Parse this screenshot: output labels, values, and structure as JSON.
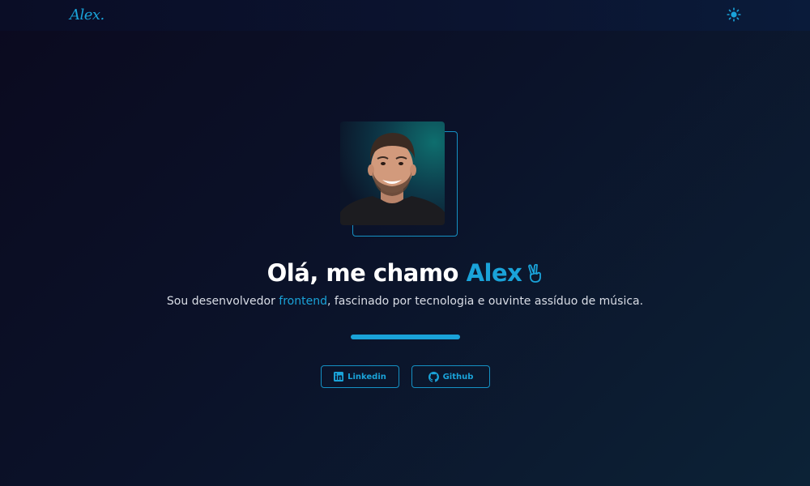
{
  "navbar": {
    "logo": "Alex."
  },
  "hero": {
    "greeting": "Olá, me chamo",
    "name": "Alex",
    "subtitle_prefix": "Sou desenvolvedor",
    "subtitle_highlight": "frontend",
    "subtitle_suffix": ", fascinado por tecnologia e ouvinte assíduo de música."
  },
  "buttons": {
    "linkedin_label": "Linkedin",
    "github_label": "Github"
  },
  "icons": {
    "theme": "sun-icon",
    "linkedin": "linkedin-icon",
    "github": "github-icon",
    "greeting": "victory-hand-icon"
  },
  "colors": {
    "accent": "#1aa3d9",
    "background": "#0b1229",
    "text": "#ffffff"
  }
}
